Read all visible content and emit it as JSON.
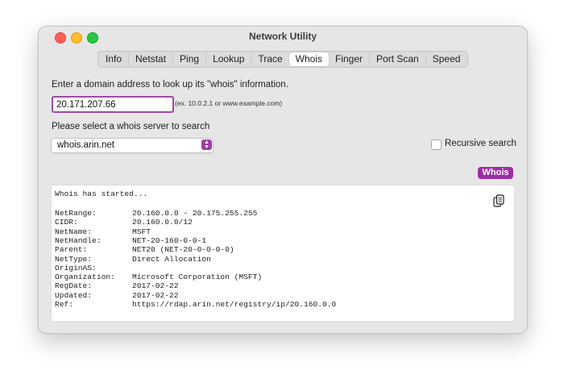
{
  "window": {
    "title": "Network Utility"
  },
  "tabs": [
    "Info",
    "Netstat",
    "Ping",
    "Lookup",
    "Trace",
    "Whois",
    "Finger",
    "Port Scan",
    "Speed"
  ],
  "active_tab": "Whois",
  "form": {
    "domain_prompt": "Enter a domain address to look up its \"whois\" information.",
    "domain_value": "20.171.207.66",
    "domain_hint": "(ex. 10.0.2.1 or www.example.com)",
    "server_prompt": "Please select a whois server to search",
    "server_value": "whois.arin.net",
    "recursive_label": "Recursive search",
    "recursive_checked": false,
    "whois_button": "Whois"
  },
  "output": {
    "started": "Whois has started...",
    "rows": [
      {
        "key": "NetRange:",
        "value": "20.160.0.0 - 20.175.255.255"
      },
      {
        "key": "CIDR:",
        "value": "20.160.0.0/12"
      },
      {
        "key": "NetName:",
        "value": "MSFT"
      },
      {
        "key": "NetHandle:",
        "value": "NET-20-160-0-0-1"
      },
      {
        "key": "Parent:",
        "value": "NET20 (NET-20-0-0-0-0)"
      },
      {
        "key": "NetType:",
        "value": "Direct Allocation"
      },
      {
        "key": "OriginAS:",
        "value": ""
      },
      {
        "key": "Organization:",
        "value": "Microsoft Corporation (MSFT)"
      },
      {
        "key": "RegDate:",
        "value": "2017-02-22"
      },
      {
        "key": "Updated:",
        "value": "2017-02-22"
      },
      {
        "key": "Ref:",
        "value": "https://rdap.arin.net/registry/ip/20.160.0.0"
      }
    ],
    "copy_icon": "copy-icon"
  },
  "colors": {
    "accent": "#9b2fa3",
    "window_bg": "#e6e6e6",
    "close": "#fe5f57",
    "minimize": "#febc2e",
    "maximize": "#28c840"
  }
}
